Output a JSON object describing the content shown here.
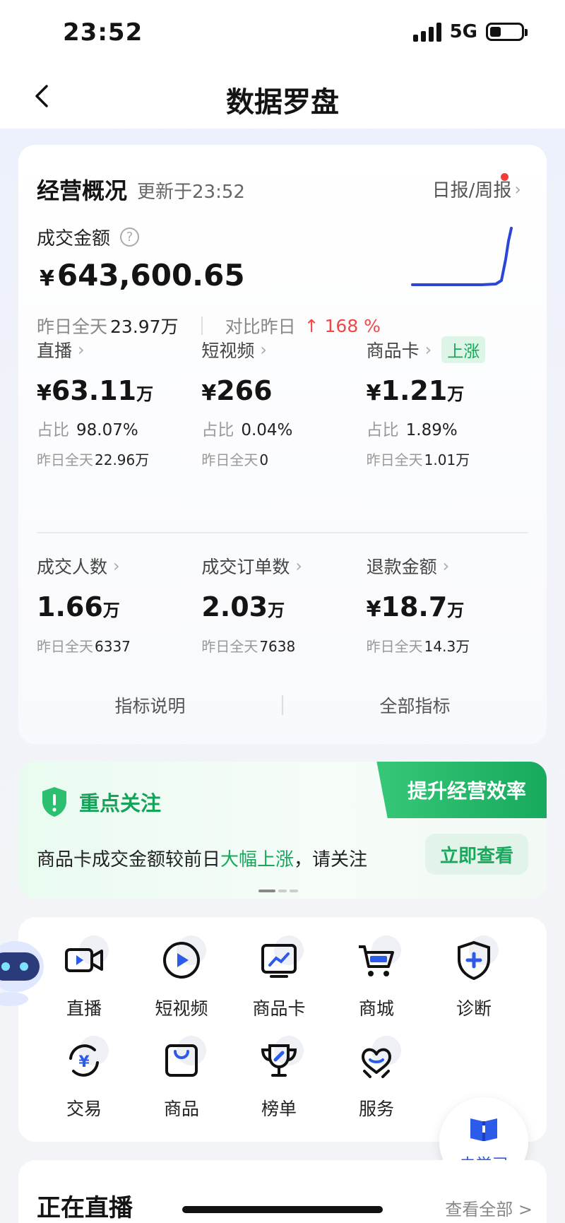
{
  "status": {
    "time": "23:52",
    "network": "5G",
    "battery_level": 0.35
  },
  "nav": {
    "title": "数据罗盘"
  },
  "overview": {
    "title": "经营概况",
    "updated": "更新于23:52",
    "report_link": "日报/周报",
    "gmv_label": "成交金额",
    "gmv_currency": "¥",
    "gmv_value": "643,600.65",
    "yesterday_label": "昨日全天",
    "yesterday_value": "23.97万",
    "compare_label": "对比昨日",
    "compare_change": "↑ 168 %",
    "trend_color": "#2b45d8",
    "channels": [
      {
        "label": "直播",
        "currency": "¥",
        "value": "63.11",
        "unit": "万",
        "share_label": "占比",
        "share": "98.07%",
        "yest_label": "昨日全天",
        "yest": "22.96万"
      },
      {
        "label": "短视频",
        "currency": "¥",
        "value": "266",
        "unit": "",
        "share_label": "占比",
        "share": "0.04%",
        "yest_label": "昨日全天",
        "yest": "0"
      },
      {
        "label": "商品卡",
        "tag": "上涨",
        "currency": "¥",
        "value": "1.21",
        "unit": "万",
        "share_label": "占比",
        "share": "1.89%",
        "yest_label": "昨日全天",
        "yest": "1.01万"
      }
    ],
    "metrics": [
      {
        "label": "成交人数",
        "currency": "",
        "value": "1.66",
        "unit": "万",
        "yest_label": "昨日全天",
        "yest": "6337"
      },
      {
        "label": "成交订单数",
        "currency": "",
        "value": "2.03",
        "unit": "万",
        "yest_label": "昨日全天",
        "yest": "7638"
      },
      {
        "label": "退款金额",
        "currency": "¥",
        "value": "18.7",
        "unit": "万",
        "yest_label": "昨日全天",
        "yest": "14.3万"
      }
    ],
    "link_explain": "指标说明",
    "link_all": "全部指标"
  },
  "focus": {
    "title": "重点关注",
    "ribbon": "提升经营效率",
    "text_before": "商品卡成交金额较前日",
    "text_highlight": "大幅上涨",
    "text_after": "，请关注",
    "button": "立即查看",
    "accent": "#16a85b"
  },
  "tools": [
    {
      "label": "直播",
      "icon": "video-camera-icon"
    },
    {
      "label": "短视频",
      "icon": "play-circle-icon"
    },
    {
      "label": "商品卡",
      "icon": "chart-card-icon"
    },
    {
      "label": "商城",
      "icon": "shopping-cart-icon"
    },
    {
      "label": "诊断",
      "icon": "shield-plus-icon"
    },
    {
      "label": "交易",
      "icon": "yuan-exchange-icon"
    },
    {
      "label": "商品",
      "icon": "shopping-bag-icon"
    },
    {
      "label": "榜单",
      "icon": "trophy-icon"
    },
    {
      "label": "服务",
      "icon": "heart-hand-icon"
    }
  ],
  "learn": {
    "label": "去学习",
    "icon": "book-icon"
  },
  "live": {
    "title": "正在直播",
    "more": "查看全部 >"
  }
}
